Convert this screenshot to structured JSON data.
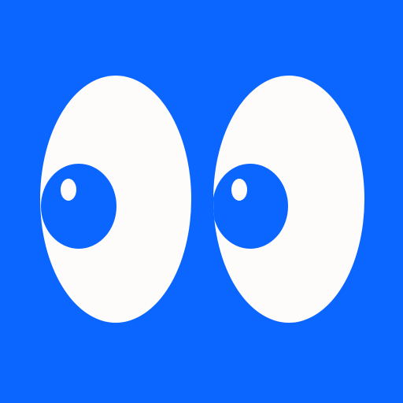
{
  "icon": {
    "name": "googly-eyes-icon",
    "colors": {
      "background": "#0a66ff",
      "sclera": "#fefbfb",
      "pupil": "#0a66ff",
      "highlight": "#fefbfb"
    }
  }
}
